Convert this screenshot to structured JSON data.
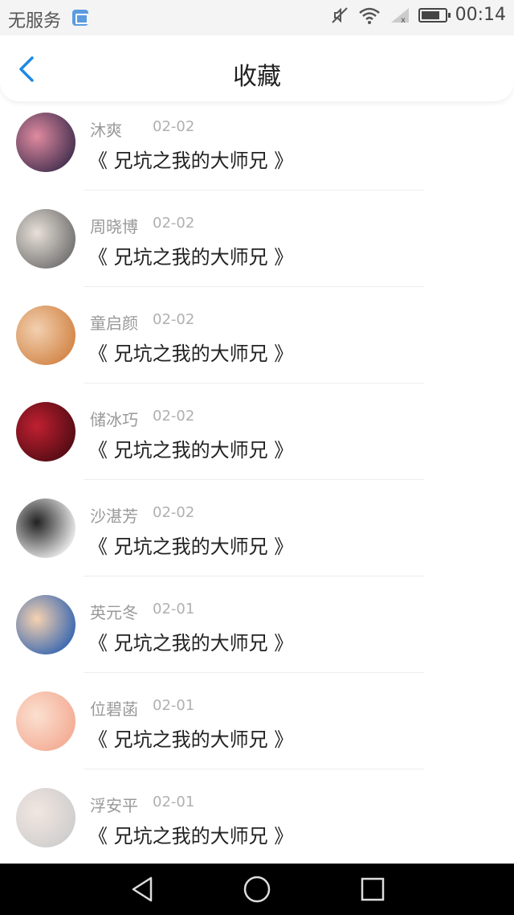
{
  "status_bar": {
    "carrier": "无服务",
    "time": "00:14",
    "icons": [
      "image-notification-icon",
      "mute-icon",
      "wifi-icon",
      "signal-icon",
      "battery-icon"
    ]
  },
  "header": {
    "title": "收藏",
    "back_icon": "chevron-left-icon"
  },
  "accent_color": "#1e88e5",
  "items": [
    {
      "name": "沐爽",
      "date": "02-02",
      "title": "《 兄坑之我的大师兄 》",
      "avatar_colors": [
        "#3a2a4a",
        "#e08aa0"
      ]
    },
    {
      "name": "周晓博",
      "date": "02-02",
      "title": "《 兄坑之我的大师兄 》",
      "avatar_colors": [
        "#6a6a6a",
        "#e8e0d8"
      ]
    },
    {
      "name": "童启颜",
      "date": "02-02",
      "title": "《 兄坑之我的大师兄 》",
      "avatar_colors": [
        "#d08040",
        "#f2d0b0"
      ]
    },
    {
      "name": "储冰巧",
      "date": "02-02",
      "title": "《 兄坑之我的大师兄 》",
      "avatar_colors": [
        "#4a0a12",
        "#c02030"
      ]
    },
    {
      "name": "沙湛芳",
      "date": "02-02",
      "title": "《 兄坑之我的大师兄 》",
      "avatar_colors": [
        "#ffffff",
        "#222222"
      ]
    },
    {
      "name": "英元冬",
      "date": "02-01",
      "title": "《 兄坑之我的大师兄 》",
      "avatar_colors": [
        "#2a5fb0",
        "#f6d2b0"
      ]
    },
    {
      "name": "位碧菡",
      "date": "02-01",
      "title": "《 兄坑之我的大师兄 》",
      "avatar_colors": [
        "#f3a890",
        "#fbe0d0"
      ]
    },
    {
      "name": "浮安平",
      "date": "02-01",
      "title": "《 兄坑之我的大师兄 》",
      "avatar_colors": [
        "#cccccc",
        "#f2e6e0"
      ]
    }
  ],
  "nav_bar": {
    "icons": [
      "triangle-back-icon",
      "circle-home-icon",
      "square-recents-icon"
    ]
  }
}
